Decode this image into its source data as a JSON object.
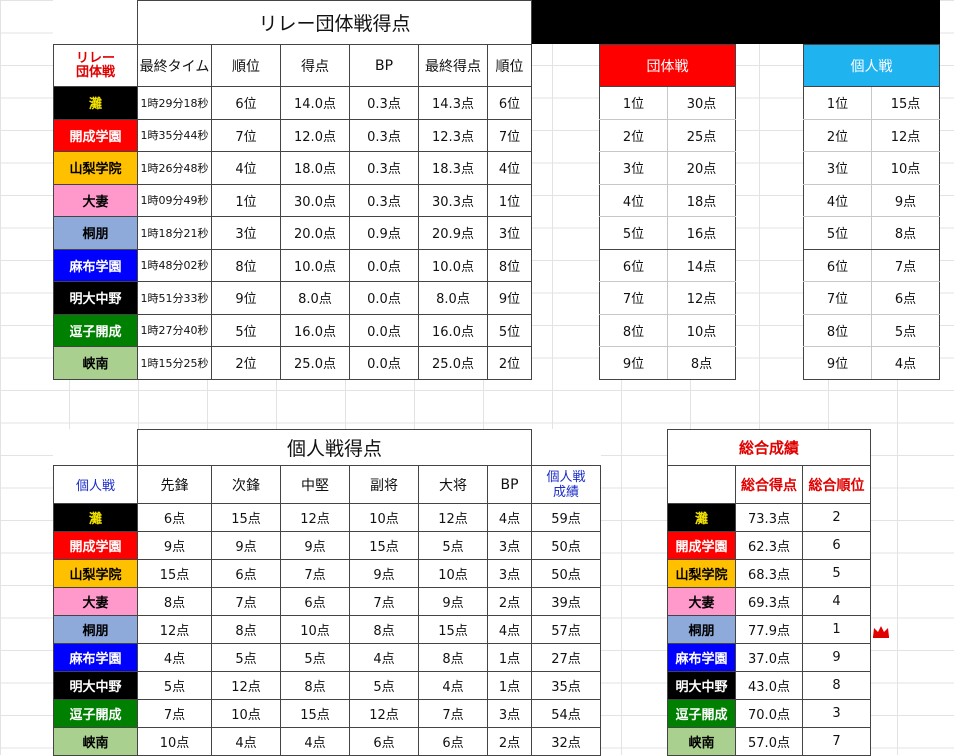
{
  "relay": {
    "title": "リレー団体戦得点",
    "corner": "リレー\n団体戦",
    "headers": [
      "最終タイム",
      "順位",
      "得点",
      "BP",
      "最終得点",
      "順位"
    ],
    "rows": [
      {
        "team": "灘",
        "time": "1時29分18秒",
        "rank": "6位",
        "score": "14.0点",
        "bp": "0.3点",
        "final": "14.3点",
        "frank": "6位"
      },
      {
        "team": "開成学園",
        "time": "1時35分44秒",
        "rank": "7位",
        "score": "12.0点",
        "bp": "0.3点",
        "final": "12.3点",
        "frank": "7位"
      },
      {
        "team": "山梨学院",
        "time": "1時26分48秒",
        "rank": "4位",
        "score": "18.0点",
        "bp": "0.3点",
        "final": "18.3点",
        "frank": "4位"
      },
      {
        "team": "大妻",
        "time": "1時09分49秒",
        "rank": "1位",
        "score": "30.0点",
        "bp": "0.3点",
        "final": "30.3点",
        "frank": "1位"
      },
      {
        "team": "桐朋",
        "time": "1時18分21秒",
        "rank": "3位",
        "score": "20.0点",
        "bp": "0.9点",
        "final": "20.9点",
        "frank": "3位"
      },
      {
        "team": "麻布学園",
        "time": "1時48分02秒",
        "rank": "8位",
        "score": "10.0点",
        "bp": "0.0点",
        "final": "10.0点",
        "frank": "8位"
      },
      {
        "team": "明大中野",
        "time": "1時51分33秒",
        "rank": "9位",
        "score": "8.0点",
        "bp": "0.0点",
        "final": "8.0点",
        "frank": "9位"
      },
      {
        "team": "逗子開成",
        "time": "1時27分40秒",
        "rank": "5位",
        "score": "16.0点",
        "bp": "0.0点",
        "final": "16.0点",
        "frank": "5位"
      },
      {
        "team": "峡南",
        "time": "1時15分25秒",
        "rank": "2位",
        "score": "25.0点",
        "bp": "0.0点",
        "final": "25.0点",
        "frank": "2位"
      }
    ]
  },
  "team_points": {
    "title": "団体戦",
    "rows": [
      [
        "1位",
        "30点"
      ],
      [
        "2位",
        "25点"
      ],
      [
        "3位",
        "20点"
      ],
      [
        "4位",
        "18点"
      ],
      [
        "5位",
        "16点"
      ],
      [
        "6位",
        "14点"
      ],
      [
        "7位",
        "12点"
      ],
      [
        "8位",
        "10点"
      ],
      [
        "9位",
        "8点"
      ]
    ]
  },
  "indiv_points": {
    "title": "個人戦",
    "rows": [
      [
        "1位",
        "15点"
      ],
      [
        "2位",
        "12点"
      ],
      [
        "3位",
        "10点"
      ],
      [
        "4位",
        "9点"
      ],
      [
        "5位",
        "8点"
      ],
      [
        "6位",
        "7点"
      ],
      [
        "7位",
        "6点"
      ],
      [
        "8位",
        "5点"
      ],
      [
        "9位",
        "4点"
      ]
    ]
  },
  "individual": {
    "title": "個人戦得点",
    "corner": "個人戦",
    "headers": [
      "先鋒",
      "次鋒",
      "中堅",
      "副将",
      "大将",
      "BP"
    ],
    "result_header": "個人戦\n成績",
    "rows": [
      {
        "team": "灘",
        "v": [
          "6点",
          "15点",
          "12点",
          "10点",
          "12点",
          "4点"
        ],
        "total": "59点"
      },
      {
        "team": "開成学園",
        "v": [
          "9点",
          "9点",
          "9点",
          "15点",
          "5点",
          "3点"
        ],
        "total": "50点"
      },
      {
        "team": "山梨学院",
        "v": [
          "15点",
          "6点",
          "7点",
          "9点",
          "10点",
          "3点"
        ],
        "total": "50点"
      },
      {
        "team": "大妻",
        "v": [
          "8点",
          "7点",
          "6点",
          "7点",
          "9点",
          "2点"
        ],
        "total": "39点"
      },
      {
        "team": "桐朋",
        "v": [
          "12点",
          "8点",
          "10点",
          "8点",
          "15点",
          "4点"
        ],
        "total": "57点"
      },
      {
        "team": "麻布学園",
        "v": [
          "4点",
          "5点",
          "5点",
          "4点",
          "8点",
          "1点"
        ],
        "total": "27点"
      },
      {
        "team": "明大中野",
        "v": [
          "5点",
          "12点",
          "8点",
          "5点",
          "4点",
          "1点"
        ],
        "total": "35点"
      },
      {
        "team": "逗子開成",
        "v": [
          "7点",
          "10点",
          "15点",
          "12点",
          "7点",
          "3点"
        ],
        "total": "54点"
      },
      {
        "team": "峡南",
        "v": [
          "10点",
          "4点",
          "4点",
          "6点",
          "6点",
          "2点"
        ],
        "total": "32点"
      }
    ]
  },
  "overall": {
    "title": "総合成績",
    "headers": [
      "総合得点",
      "総合順位"
    ],
    "rows": [
      {
        "team": "灘",
        "score": "73.3点",
        "rank": "2"
      },
      {
        "team": "開成学園",
        "score": "62.3点",
        "rank": "6"
      },
      {
        "team": "山梨学院",
        "score": "68.3点",
        "rank": "5"
      },
      {
        "team": "大妻",
        "score": "69.3点",
        "rank": "4"
      },
      {
        "team": "桐朋",
        "score": "77.9点",
        "rank": "1"
      },
      {
        "team": "麻布学園",
        "score": "37.0点",
        "rank": "9"
      },
      {
        "team": "明大中野",
        "score": "43.0点",
        "rank": "8"
      },
      {
        "team": "逗子開成",
        "score": "70.0点",
        "rank": "3"
      },
      {
        "team": "峡南",
        "score": "57.0点",
        "rank": "7"
      }
    ]
  },
  "team_colors": {
    "灘": {
      "bg": "#000000",
      "fg": "#f2e200"
    },
    "開成学園": {
      "bg": "#ff0000",
      "fg": "#ffffff"
    },
    "山梨学院": {
      "bg": "#ffc000",
      "fg": "#000000"
    },
    "大妻": {
      "bg": "#ff99cc",
      "fg": "#000000"
    },
    "桐朋": {
      "bg": "#8eaadb",
      "fg": "#000000"
    },
    "麻布学園": {
      "bg": "#0000ff",
      "fg": "#ffffff"
    },
    "明大中野": {
      "bg": "#000000",
      "fg": "#ffffff"
    },
    "逗子開成": {
      "bg": "#008000",
      "fg": "#ffffff"
    },
    "峡南": {
      "bg": "#a9d08e",
      "fg": "#000000"
    }
  },
  "accent": {
    "team_header": "#ff0000",
    "indiv_header": "#1fb3f0",
    "corner_red": "#e00000",
    "corner_blue": "#1a2cc8"
  },
  "crown_icon": "crown-icon"
}
